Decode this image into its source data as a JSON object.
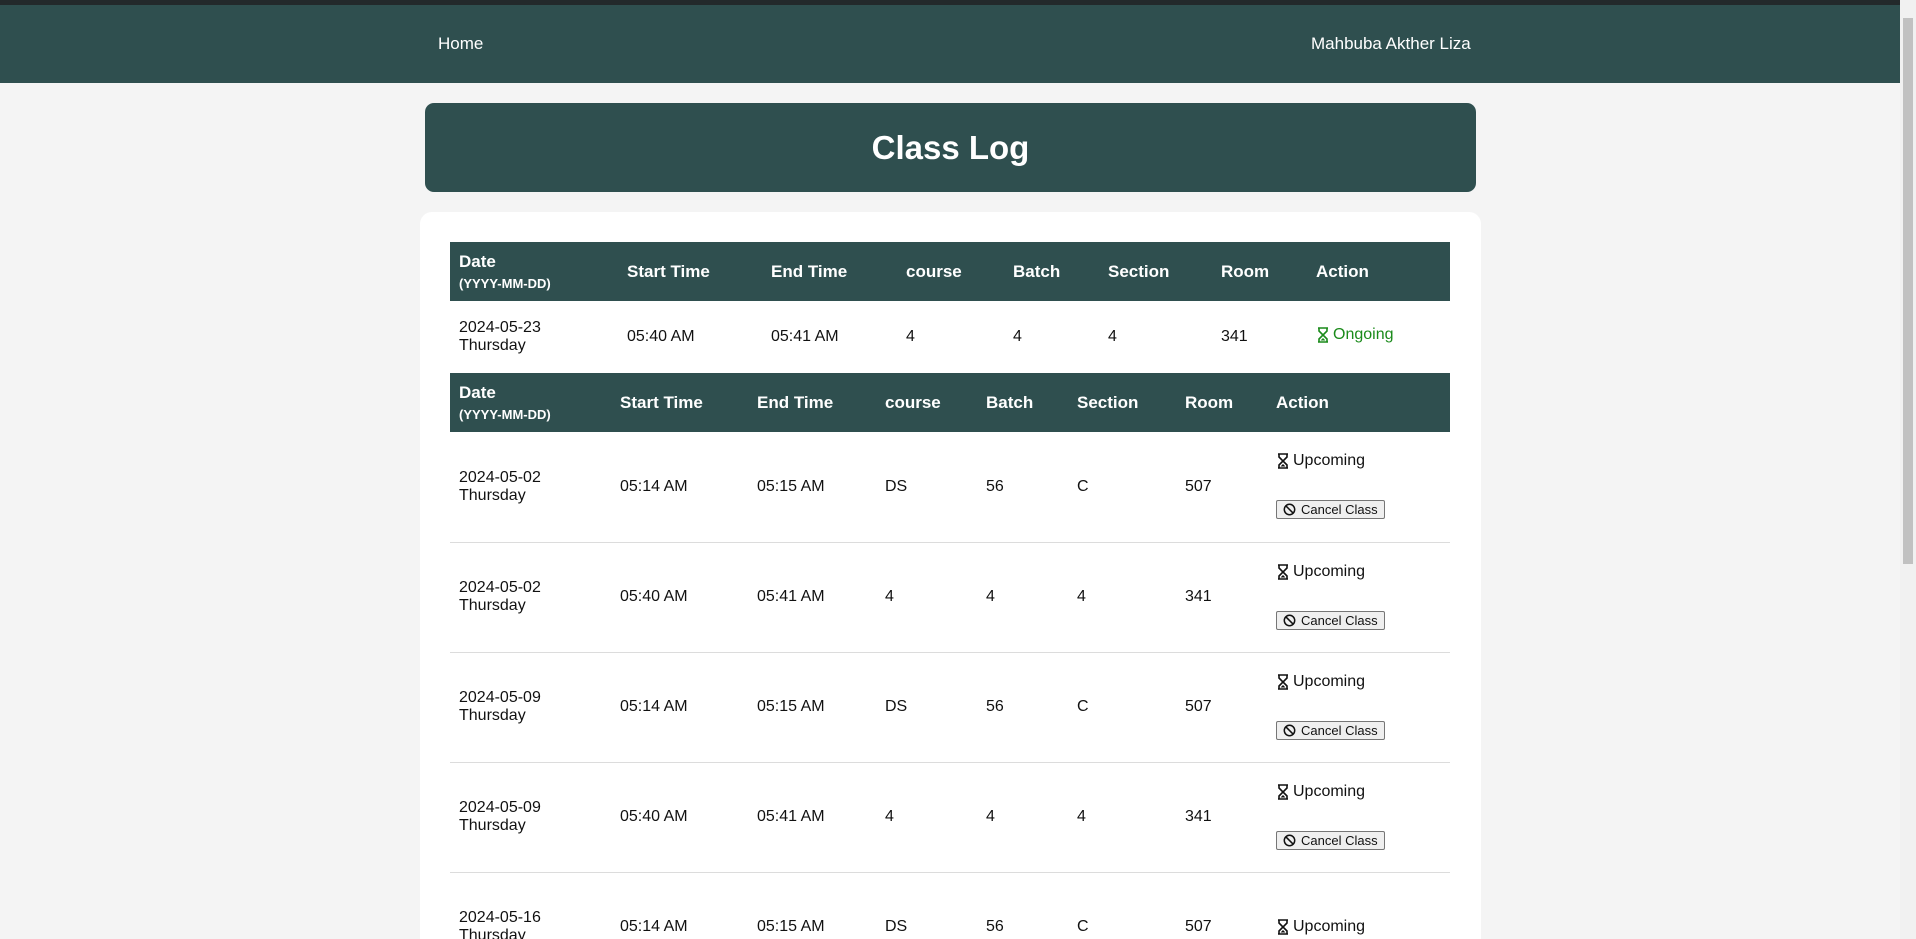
{
  "nav": {
    "home": "Home",
    "user": "Mahbuba Akther Liza"
  },
  "page_title": "Class Log",
  "headers": {
    "date": "Date",
    "date_format": "(YYYY-MM-DD)",
    "start": "Start Time",
    "end": "End Time",
    "course": "course",
    "batch": "Batch",
    "section": "Section",
    "room": "Room",
    "action": "Action"
  },
  "ongoing": [
    {
      "date": "2024-05-23",
      "day": "Thursday",
      "start": "05:40 AM",
      "end": "05:41 AM",
      "course": "4",
      "batch": "4",
      "section": "4",
      "room": "341",
      "status": "Ongoing"
    }
  ],
  "upcoming": [
    {
      "date": "2024-05-02",
      "day": "Thursday",
      "start": "05:14 AM",
      "end": "05:15 AM",
      "course": "DS",
      "batch": "56",
      "section": "C",
      "room": "507",
      "status": "Upcoming",
      "action": "Cancel Class"
    },
    {
      "date": "2024-05-02",
      "day": "Thursday",
      "start": "05:40 AM",
      "end": "05:41 AM",
      "course": "4",
      "batch": "4",
      "section": "4",
      "room": "341",
      "status": "Upcoming",
      "action": "Cancel Class"
    },
    {
      "date": "2024-05-09",
      "day": "Thursday",
      "start": "05:14 AM",
      "end": "05:15 AM",
      "course": "DS",
      "batch": "56",
      "section": "C",
      "room": "507",
      "status": "Upcoming",
      "action": "Cancel Class"
    },
    {
      "date": "2024-05-09",
      "day": "Thursday",
      "start": "05:40 AM",
      "end": "05:41 AM",
      "course": "4",
      "batch": "4",
      "section": "4",
      "room": "341",
      "status": "Upcoming",
      "action": "Cancel Class"
    },
    {
      "date": "2024-05-16",
      "day": "Thursday",
      "start": "05:14 AM",
      "end": "05:15 AM",
      "course": "DS",
      "batch": "56",
      "section": "C",
      "room": "507",
      "status": "Upcoming",
      "action": ""
    }
  ],
  "colors": {
    "primary": "#2f4f4f",
    "ongoing": "#1a8a1a"
  },
  "icons": {
    "status": "hourglass-icon",
    "cancel": "ban-icon"
  }
}
